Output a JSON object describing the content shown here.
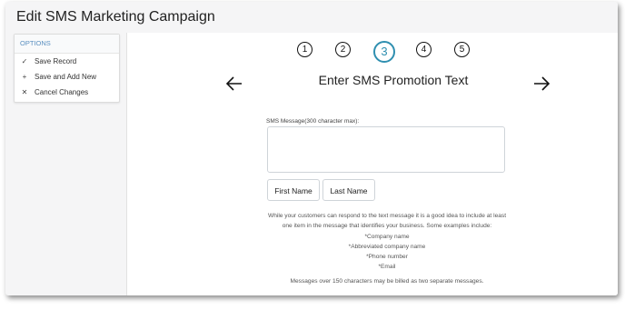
{
  "page": {
    "title": "Edit SMS Marketing Campaign"
  },
  "options": {
    "header": "OPTIONS",
    "items": [
      {
        "icon": "check-circle-icon",
        "glyph": "✓",
        "label": "Save Record"
      },
      {
        "icon": "plus-icon",
        "glyph": "+",
        "label": "Save and Add New"
      },
      {
        "icon": "close-icon",
        "glyph": "✕",
        "label": "Cancel Changes"
      }
    ]
  },
  "wizard": {
    "steps": [
      "1",
      "2",
      "3",
      "4",
      "5"
    ],
    "active_step": 3,
    "title": "Enter SMS Promotion Text",
    "prev_icon": "arrow-left-icon",
    "next_icon": "arrow-right-icon"
  },
  "sms": {
    "label": "SMS Message(300 character max):",
    "value": "",
    "tokens": [
      "First Name",
      "Last Name"
    ],
    "help": {
      "intro": "While your customers can respond to the text message it is a good idea to include at least one item in the message that identifies your business. Some examples include:",
      "examples": [
        "*Company name",
        "*Abbreviated company name",
        "*Phone number",
        "*Email"
      ]
    },
    "note": "Messages over 150 characters may be billed as two separate messages."
  },
  "colors": {
    "accent": "#2f8fb0",
    "options_header": "#5a8fc0"
  }
}
